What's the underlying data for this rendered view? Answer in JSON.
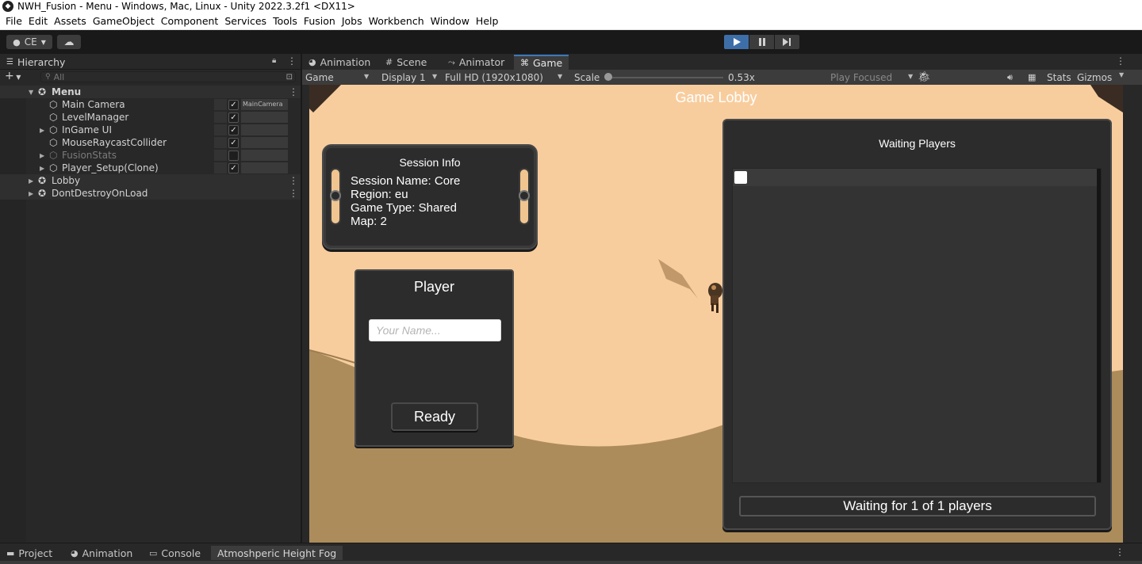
{
  "window": {
    "title": "NWH_Fusion - Menu - Windows, Mac, Linux - Unity 2022.3.2f1 <DX11>"
  },
  "menubar": [
    "File",
    "Edit",
    "Assets",
    "GameObject",
    "Component",
    "Services",
    "Tools",
    "Fusion",
    "Jobs",
    "Workbench",
    "Window",
    "Help"
  ],
  "toolbar": {
    "account_label": "CE",
    "play_active": true
  },
  "hierarchy": {
    "tab_label": "Hierarchy",
    "search_placeholder": "All",
    "rows": [
      {
        "label": "Menu",
        "type": "scene",
        "expanded": true
      },
      {
        "label": "Main Camera",
        "checked": true,
        "tag": "MainCamera"
      },
      {
        "label": "LevelManager",
        "checked": true,
        "tag": ""
      },
      {
        "label": "InGame UI",
        "checked": true,
        "tag": "",
        "expandable": true
      },
      {
        "label": "MouseRaycastCollider",
        "checked": true,
        "tag": ""
      },
      {
        "label": "FusionStats",
        "checked": false,
        "tag": "",
        "expandable": true,
        "disabled": true
      },
      {
        "label": "Player_Setup(Clone)",
        "checked": true,
        "tag": "",
        "expandable": true
      },
      {
        "label": "Lobby",
        "type": "scene",
        "expanded": false
      },
      {
        "label": "DontDestroyOnLoad",
        "type": "scene",
        "expanded": false
      }
    ]
  },
  "game_view": {
    "tabs": [
      {
        "label": "Animation",
        "icon": "animation-icon"
      },
      {
        "label": "Scene",
        "icon": "scene-grid-icon"
      },
      {
        "label": "Animator",
        "icon": "animator-icon"
      },
      {
        "label": "Game",
        "icon": "gamepad-icon",
        "active": true
      }
    ],
    "toolbar": {
      "display_mode": "Game",
      "display": "Display 1",
      "resolution": "Full HD (1920x1080)",
      "scale_label": "Scale",
      "scale_value": "0.53x",
      "play_mode": "Play Focused",
      "stats_label": "Stats",
      "gizmos_label": "Gizmos"
    }
  },
  "game": {
    "lobby_title": "Game Lobby",
    "session": {
      "title": "Session Info",
      "name_line": "Session Name: Core",
      "region_line": "Region: eu",
      "type_line": "Game Type: Shared",
      "map_line": "Map: 2"
    },
    "player": {
      "title": "Player",
      "name_placeholder": "Your Name...",
      "ready_label": "Ready"
    },
    "waiting": {
      "title": "Waiting Players",
      "status": "Waiting for 1 of 1 players"
    }
  },
  "bottom_tabs": [
    {
      "label": "Project",
      "icon": "folder-icon"
    },
    {
      "label": "Animation",
      "icon": "animation-icon"
    },
    {
      "label": "Console",
      "icon": "console-icon"
    },
    {
      "label": "Atmoshperic Height Fog",
      "icon": "",
      "active": true
    }
  ],
  "colors": {
    "editor_bg": "#282828",
    "play_blue": "#3e6ea8",
    "sand_light": "#f8cd9e",
    "sand_dark": "#ad8c5b",
    "ui_panel": "#2c2c2c"
  }
}
